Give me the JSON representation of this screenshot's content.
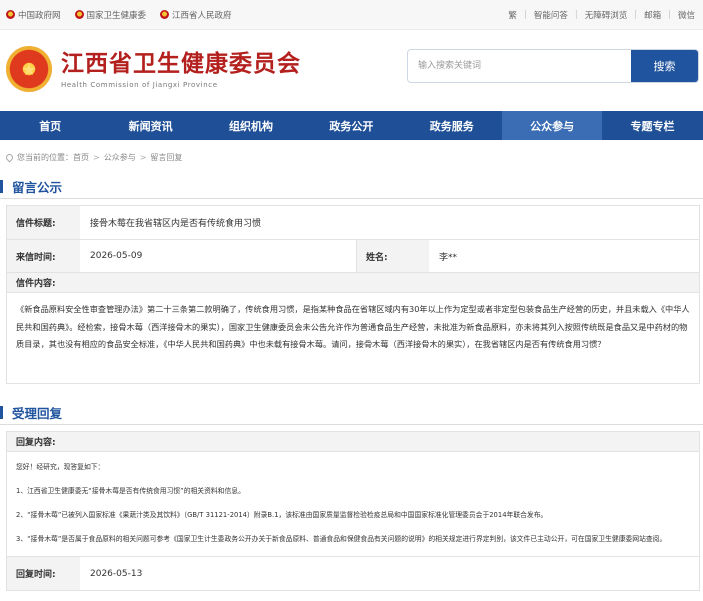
{
  "topbar": {
    "links": [
      "中国政府网",
      "国家卫生健康委",
      "江西省人民政府"
    ],
    "tools": [
      "繁",
      "智能问答",
      "无障碍浏览",
      "邮箱",
      "微信"
    ]
  },
  "header": {
    "site_name_cn": "江西省卫生健康委员会",
    "site_name_en": "Health Commission of Jiangxi Province",
    "search_placeholder": "输入搜索关键词",
    "search_button": "搜索"
  },
  "nav": {
    "items": [
      "首页",
      "新闻资讯",
      "组织机构",
      "政务公开",
      "政务服务",
      "公众参与",
      "专题专栏"
    ],
    "active_index": 5
  },
  "breadcrumb": {
    "prefix": "您当前的位置：",
    "items": [
      "首页",
      "公众参与",
      "留言回复"
    ],
    "separator": ">"
  },
  "letter": {
    "section_title": "留言公示",
    "subject_label": "信件标题:",
    "subject": "接骨木莓在我省辖区内是否有传统食用习惯",
    "date_label": "来信时间:",
    "date": "2026-05-09",
    "name_label": "姓名:",
    "name": "李**",
    "content_label": "信件内容:",
    "content": "《新食品原料安全性审查管理办法》第二十三条第二款明确了，传统食用习惯，是指某种食品在省辖区域内有30年以上作为定型或者非定型包装食品生产经营的历史，并且未载入《中华人民共和国药典》。经检索，接骨木莓（西洋接骨木的果实），国家卫生健康委员会未公告允许作为普通食品生产经营，未批准为新食品原料，亦未将其列入按照传统既是食品又是中药材的物质目录，其也没有相应的食品安全标准，《中华人民共和国药典》中也未载有接骨木莓。请问，接骨木莓（西洋接骨木的果实），在我省辖区内是否有传统食用习惯？"
  },
  "reply": {
    "section_title": "受理回复",
    "content_label": "回复内容:",
    "greeting": "您好！经研究，现答复如下：",
    "points": [
      "1、江西省卫生健康委无“接骨木莓是否有传统食用习惯”的相关资料和信息。",
      "2、“接骨木莓”已被列入国家标准《果蔬汁类及其饮料》（GB/T 31121-2014）附录B.1，该标准由国家质量监督检验检疫总局和中国国家标准化管理委员会于2014年联合发布。",
      "3、“接骨木莓”是否属于食品原料的相关问题可参考《国家卫生计生委政务公开办关于新食品原料、普通食品和保健食品有关问题的说明》的相关规定进行界定判别，该文件已主动公开，可在国家卫生健康委网站查阅。"
    ],
    "date_label": "回复时间:",
    "date": "2026-05-13"
  }
}
